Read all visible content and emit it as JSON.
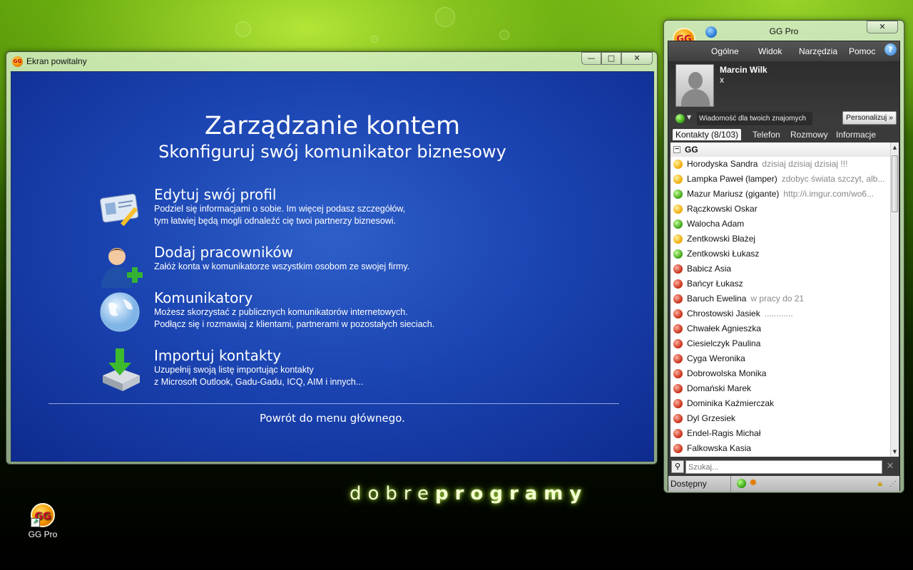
{
  "welcome_window": {
    "title": "Ekran powitalny",
    "caption": {
      "minimize": "—",
      "maximize": "□",
      "close": "✕"
    },
    "heading": "Zarządzanie kontem",
    "subheading": "Skonfiguruj swój komunikator biznesowy",
    "options": [
      {
        "icon": "id-card-pen-icon",
        "title": "Edytuj swój profil",
        "line1": "Podziel się informacjami o sobie. Im więcej podasz szczegółów,",
        "line2": "tym łatwiej będą mogli odnaleźć cię twoi partnerzy biznesowi."
      },
      {
        "icon": "add-user-icon",
        "title": "Dodaj pracowników",
        "line1": "Załóż konta w komunikatorze wszystkim osobom ze swojej firmy.",
        "line2": ""
      },
      {
        "icon": "globe-icon",
        "title": "Komunikatory",
        "line1": "Możesz skorzystać z publicznych komunikatorów internetowych.",
        "line2": "Podłącz się i rozmawiaj z klientami, partnerami w pozostałych sieciach."
      },
      {
        "icon": "import-download-icon",
        "title": "Importuj kontakty",
        "line1": "Uzupełnij swoją listę importując kontakty",
        "line2": "z Microsoft Outlook, Gadu-Gadu, ICQ, AIM i innych..."
      }
    ],
    "back_link": "Powrót do menu głównego."
  },
  "brand": {
    "light": "dobre",
    "bold": "programy"
  },
  "desktop_icon": {
    "label": "GG Pro",
    "logo": "GG"
  },
  "gg_window": {
    "title": "GG Pro",
    "logo": "GG",
    "close": "✕",
    "menu": [
      "Ogólne",
      "Widok",
      "Narzędzia",
      "Pomoc"
    ],
    "help": "?",
    "user": {
      "name": "Marcin Wilk",
      "description": "x"
    },
    "status_message": "Wiadomość dla twoich znajomych",
    "personalize_button": "Personalizuj »",
    "tabs": [
      "Kontakty (8/103)",
      "Telefon",
      "Rozmowy",
      "Informacje"
    ],
    "group": "GG",
    "contacts": [
      {
        "name": "Horodyska Sandra",
        "desc": "dzisiaj dzisiaj dzisiaj !!!",
        "status": "away"
      },
      {
        "name": "Lampka Paweł (lamper)",
        "desc": "zdobyc świata szczyt, alb...",
        "status": "away"
      },
      {
        "name": "Mazur Mariusz (gigante)",
        "desc": "http://i.imgur.com/wo6...",
        "status": "online"
      },
      {
        "name": "Rączkowski Oskar",
        "desc": "",
        "status": "away"
      },
      {
        "name": "Walocha Adam",
        "desc": "",
        "status": "online"
      },
      {
        "name": "Zentkowski Błażej",
        "desc": "",
        "status": "away"
      },
      {
        "name": "Zentkowski Łukasz",
        "desc": "",
        "status": "online"
      },
      {
        "name": "Babicz Asia",
        "desc": "",
        "status": "offline"
      },
      {
        "name": "Bańcyr Łukasz",
        "desc": "",
        "status": "offline"
      },
      {
        "name": "Baruch Ewelina",
        "desc": "w pracy do 21",
        "status": "offline"
      },
      {
        "name": "Chrostowski Jasiek",
        "desc": "............",
        "status": "offline"
      },
      {
        "name": "Chwałek Agnieszka",
        "desc": "",
        "status": "offline"
      },
      {
        "name": "Ciesielczyk Paulina",
        "desc": "",
        "status": "offline"
      },
      {
        "name": "Cyga Weronika",
        "desc": "",
        "status": "offline"
      },
      {
        "name": "Dobrowolska Monika",
        "desc": "",
        "status": "offline"
      },
      {
        "name": "Domański Marek",
        "desc": "",
        "status": "offline"
      },
      {
        "name": "Dominika Kaźmierczak",
        "desc": "",
        "status": "offline"
      },
      {
        "name": "Dyl Grzesiek",
        "desc": "",
        "status": "offline"
      },
      {
        "name": "Endel-Ragis Michał",
        "desc": "",
        "status": "offline"
      },
      {
        "name": "Falkowska Kasia",
        "desc": "",
        "status": "offline"
      }
    ],
    "search_placeholder": "Szukaj...",
    "status_label": "Dostępny"
  }
}
